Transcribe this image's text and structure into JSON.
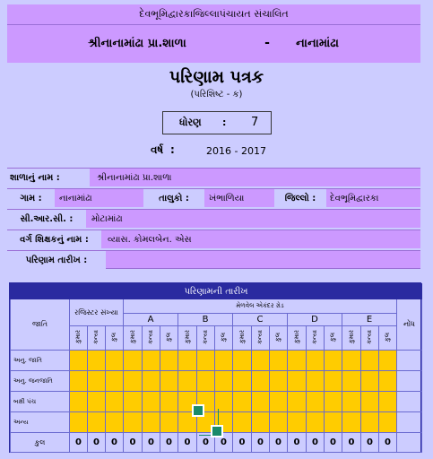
{
  "header": {
    "line1": "દેવભૂમિદ્વારકાજિલ્લાપંચાયત સંચાલિત",
    "school_name": "શ્રીનાનામાંઢા પ્રા.શાળા",
    "dash": "-",
    "village": "નાનામાંઢા"
  },
  "title": {
    "main": "પરિણામ પત્રક",
    "sub": "(પરિશિષ્ટ - ક)"
  },
  "std": {
    "label": "ધોરણ",
    "colon": ":",
    "value": "7"
  },
  "year": {
    "label": "વર્ષ",
    "colon": ":",
    "value": "2016 - 2017"
  },
  "info": {
    "school_label": "શાળાનું નામ :",
    "school_value": "શ્રીનાનામાંઢા પ્રા.શાળા",
    "gam_label": "ગામ :",
    "gam_value": "નાનામાંઢા",
    "taluka_label": "તાલુકો :",
    "taluka_value": "ખંભાળિયા",
    "jillo_label": "જિલ્લો :",
    "jillo_value": "દેવભૂમિદ્વારકા",
    "crc_label": "સી.આર.સી. :",
    "crc_value": "મોટામાંઢા",
    "teacher_label": "વર્ગ શિક્ષકનું નામ :",
    "teacher_value": "વ્યાસ. કોમલબેન. એસ",
    "date_label": "પરિણામ તારીખ :",
    "date_value": ""
  },
  "result_table": {
    "title": "પરિણામની તારીખ",
    "jati": "જાતિ",
    "registered": "રજિસ્ટર સંખ્યા",
    "grade_header": "મેળવેલ એકંદર ગ્રેડ",
    "grades": [
      "A",
      "B",
      "C",
      "D",
      "E"
    ],
    "nondh": "નોંધ",
    "sub_labels": [
      "કુમાર",
      "કન્યા",
      "કુલ"
    ],
    "rows": [
      "અનુ. જાતિ",
      "અનુ. જનજાતિ",
      "બક્ષી પંચ",
      "અન્ય"
    ],
    "total_label": "કુલ",
    "totals": [
      "0",
      "0",
      "0",
      "0",
      "0",
      "0",
      "0",
      "0",
      "0",
      "0",
      "0",
      "0",
      "0",
      "0",
      "0",
      "0",
      "0",
      "0"
    ]
  },
  "colors": {
    "purple": "#cc99ff",
    "yellow": "#ffcc00",
    "navy": "#2a2aa0",
    "green_handle": "#1a8a6a"
  }
}
